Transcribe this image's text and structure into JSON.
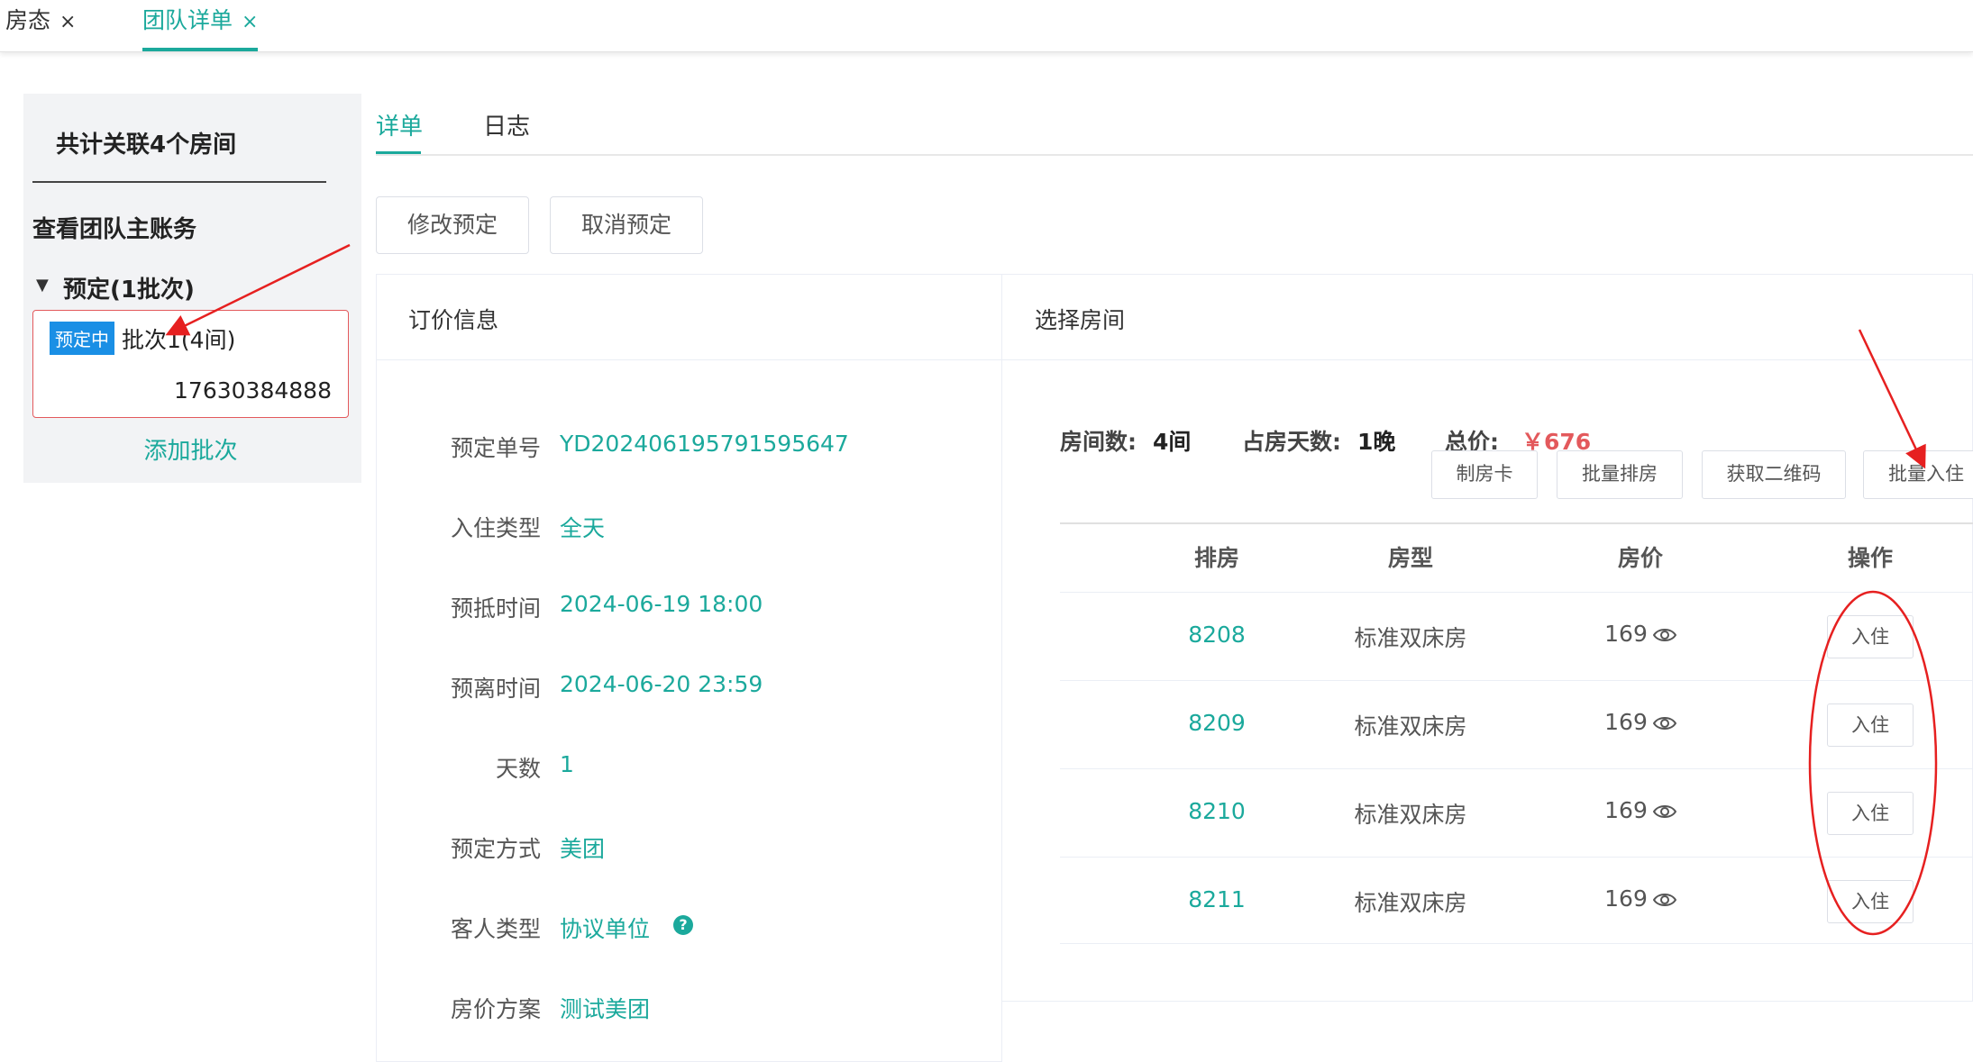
{
  "top_tabs": [
    {
      "label": "房态",
      "close": "×"
    },
    {
      "label": "团队详单",
      "close": "×"
    }
  ],
  "sidebar": {
    "room_count_text": "共计关联4个房间",
    "master_account": "查看团队主账务",
    "group_toggle": "▼",
    "group_label": "预定(1批次)",
    "batch": {
      "status": "预定中",
      "label": "批次1(4间)",
      "phone": "17630384888"
    },
    "add_batch": "添加批次"
  },
  "sub_tabs": [
    "详单",
    "日志"
  ],
  "actions": {
    "modify": "修改预定",
    "cancel": "取消预定"
  },
  "order_panel": {
    "title": "订价信息",
    "fields": [
      {
        "label": "预定单号",
        "value": "YD202406195791595647"
      },
      {
        "label": "入住类型",
        "value": "全天"
      },
      {
        "label": "预抵时间",
        "value": "2024-06-19 18:00"
      },
      {
        "label": "预离时间",
        "value": "2024-06-20 23:59"
      },
      {
        "label": "天数",
        "value": "1"
      },
      {
        "label": "预定方式",
        "value": "美团"
      },
      {
        "label": "客人类型",
        "value": "协议单位"
      },
      {
        "label": "房价方案",
        "value": "测试美团"
      }
    ],
    "help_icon": "?"
  },
  "room_panel": {
    "title": "选择房间",
    "summary": {
      "rooms_label": "房间数:",
      "rooms_value": "4间",
      "nights_label": "占房天数:",
      "nights_value": "1晚",
      "total_label": "总价:",
      "total_value": "￥676"
    },
    "buttons": [
      "制房卡",
      "批量排房",
      "获取二维码",
      "批量入住"
    ],
    "columns": [
      "排房",
      "房型",
      "房价",
      "操作"
    ],
    "rows": [
      {
        "room": "8208",
        "type": "标准双床房",
        "price": "169",
        "action": "入住"
      },
      {
        "room": "8209",
        "type": "标准双床房",
        "price": "169",
        "action": "入住"
      },
      {
        "room": "8210",
        "type": "标准双床房",
        "price": "169",
        "action": "入住"
      },
      {
        "room": "8211",
        "type": "标准双床房",
        "price": "169",
        "action": "入住"
      }
    ]
  },
  "colors": {
    "accent": "#1ba99c",
    "danger": "#e3595c",
    "badge": "#1a8fe5",
    "annotation": "#e62020"
  }
}
